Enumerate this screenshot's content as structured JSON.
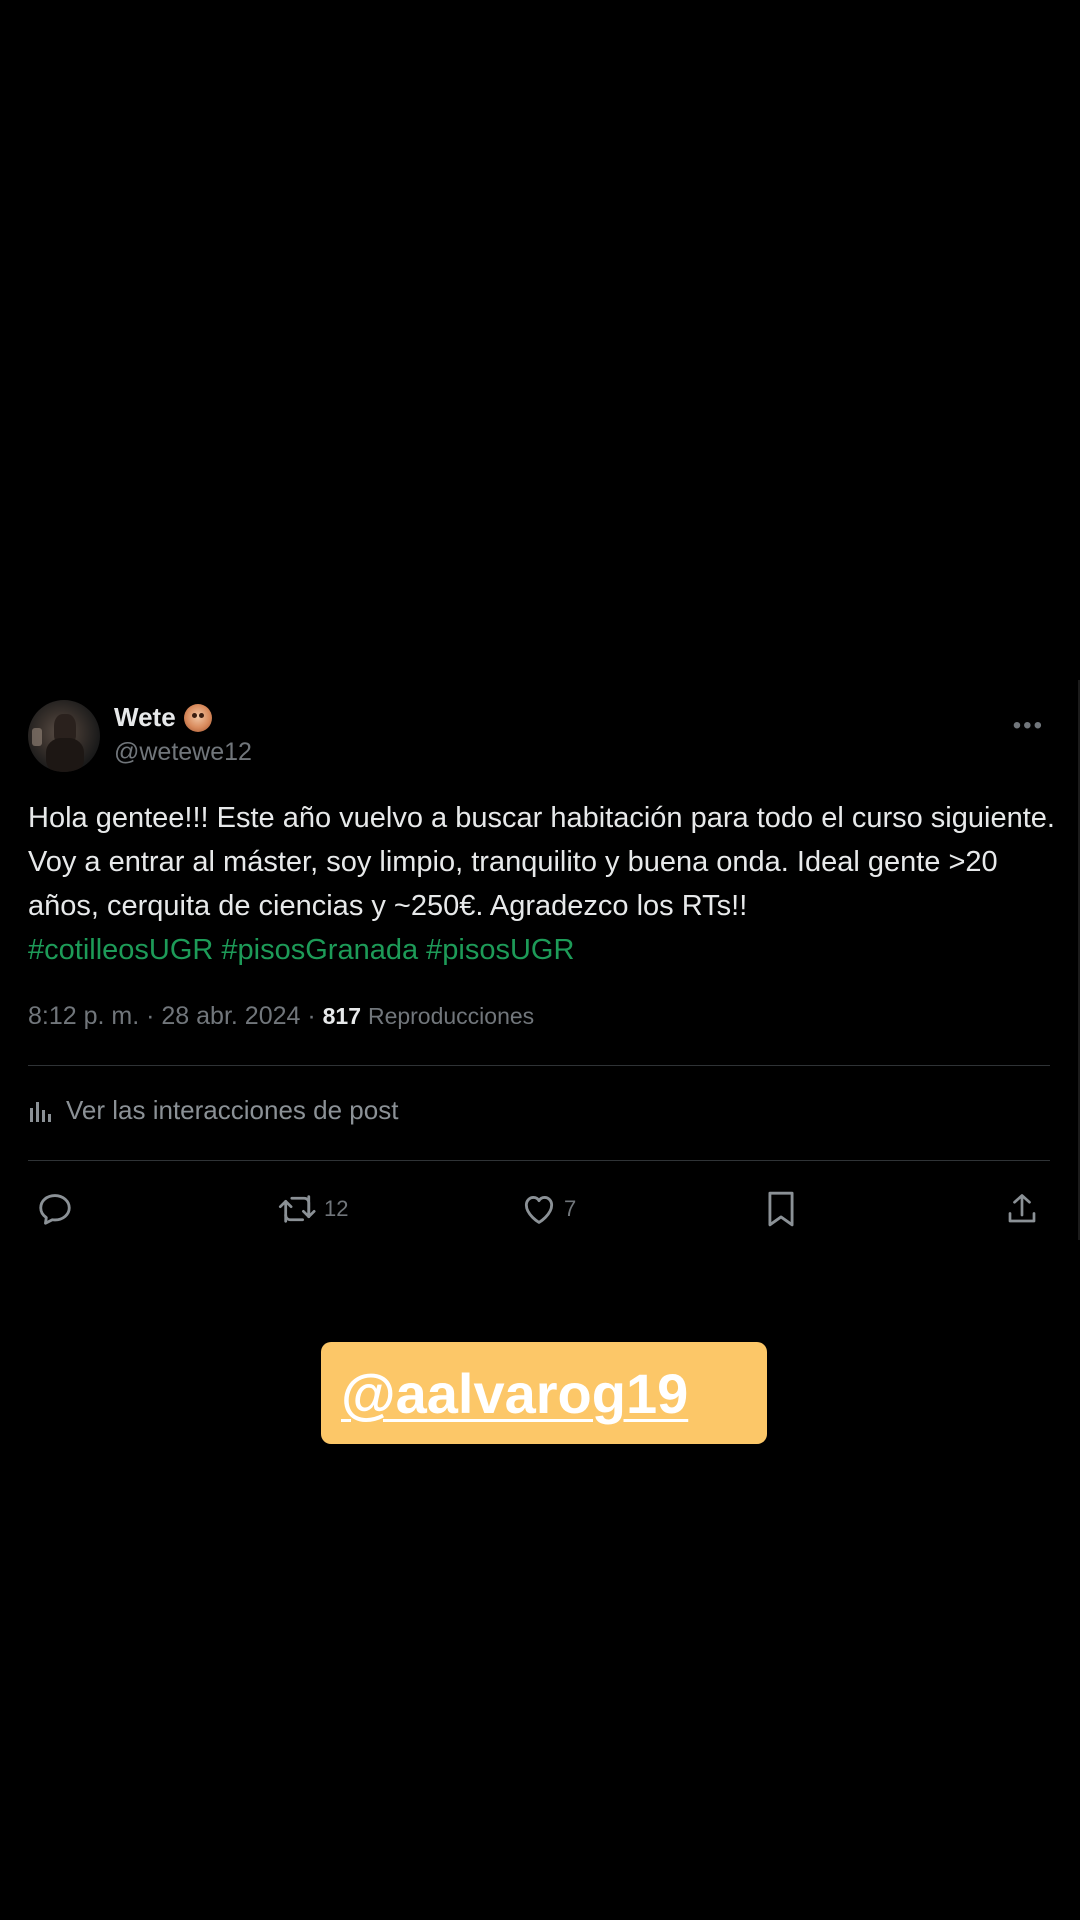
{
  "tweet": {
    "display_name": "Wete",
    "handle": "@wetewe12",
    "more_label": "•••",
    "body": "Hola gentee!!! Este año vuelvo a buscar habitación para todo el curso siguiente. Voy a entrar al máster, soy limpio, tranquilito y buena onda. Ideal gente >20 años, cerquita de ciencias y ~250€. Agradezco los RTs!!",
    "hashtags": "#cotilleosUGR #pisosGranada #pisosUGR",
    "timestamp": "8:12 p. m. · 28 abr. 2024 · ",
    "views_count": "817",
    "views_label": "Reproducciones",
    "interactions_label": "Ver las interacciones de post",
    "actions": {
      "reply_count": "",
      "retweet_count": "12",
      "like_count": "7"
    }
  },
  "sticker": {
    "mention": "@aalvarog19",
    "color": "#fcc768"
  },
  "colors": {
    "background": "#000000",
    "text": "#e7e9ea",
    "muted": "#71767b",
    "hashtag": "#1d9b58"
  }
}
